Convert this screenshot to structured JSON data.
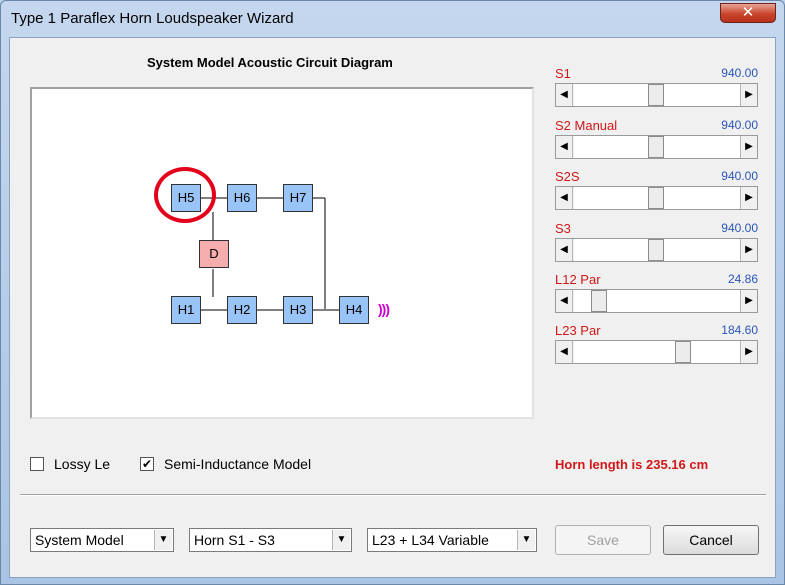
{
  "window": {
    "title": "Type 1 Paraflex Horn Loudspeaker Wizard",
    "close_symbol": "✕"
  },
  "diagram": {
    "title": "System Model Acoustic Circuit Diagram",
    "nodes": {
      "h5": "H5",
      "h6": "H6",
      "h7": "H7",
      "d": "D",
      "h1": "H1",
      "h2": "H2",
      "h3": "H3",
      "h4": "H4"
    },
    "output_waves": ")))"
  },
  "parameters": [
    {
      "name": "S1",
      "value": "940.00",
      "slider_fraction": 0.49
    },
    {
      "name": "S2 Manual",
      "value": "940.00",
      "slider_fraction": 0.49
    },
    {
      "name": "S2S",
      "value": "940.00",
      "slider_fraction": 0.49
    },
    {
      "name": "S3",
      "value": "940.00",
      "slider_fraction": 0.49
    },
    {
      "name": "L12 Par",
      "value": "24.86",
      "slider_fraction": 0.11
    },
    {
      "name": "L23 Par",
      "value": "184.60",
      "slider_fraction": 0.67
    }
  ],
  "options": {
    "lossy_le": {
      "label": "Lossy Le",
      "checked": false
    },
    "semi_inductance": {
      "label": "Semi-Inductance Model",
      "checked": true
    }
  },
  "status": {
    "horn_length": "Horn length is 235.16 cm"
  },
  "footer": {
    "model_select": "System Model",
    "horn_select": "Horn S1 - S3",
    "variable_select": "L23 + L34 Variable",
    "save_label": "Save",
    "cancel_label": "Cancel"
  },
  "colors": {
    "node_fill": "#99c4f8",
    "d_node_fill": "#f6adad",
    "highlight_circle": "#e3001b",
    "param_name": "#d01818",
    "param_value": "#2a55b8",
    "waves": "#cc00cc"
  },
  "icons": {
    "scroll_left": "scroll-left-arrow-icon",
    "scroll_right": "scroll-right-arrow-icon",
    "dropdown": "chevron-down-icon",
    "check": "checkmark-icon"
  }
}
